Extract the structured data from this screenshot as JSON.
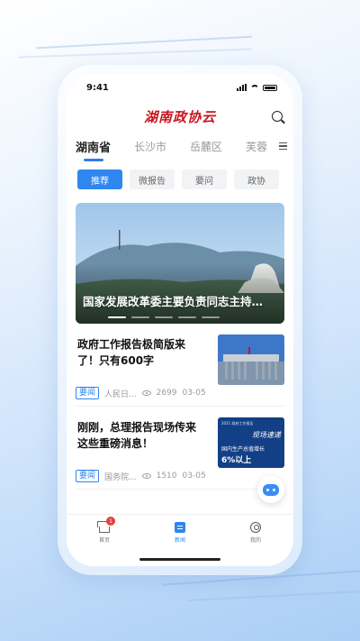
{
  "status_bar": {
    "time": "9:41"
  },
  "header": {
    "logo_text": "湖南政协云"
  },
  "region_tabs": [
    {
      "label": "湖南省",
      "active": true
    },
    {
      "label": "长沙市",
      "active": false
    },
    {
      "label": "岳麓区",
      "active": false
    },
    {
      "label": "芙蓉",
      "active": false
    }
  ],
  "category_tabs": [
    {
      "label": "推荐",
      "active": true
    },
    {
      "label": "微报告",
      "active": false
    },
    {
      "label": "要问",
      "active": false
    },
    {
      "label": "政协",
      "active": false
    }
  ],
  "banner": {
    "caption": "国家发展改革委主要负责同志主持…",
    "slides": 5,
    "active_slide": 1
  },
  "news": [
    {
      "title": "政府工作报告极简版来了！只有600字",
      "tag": "要闻",
      "source": "人民日...",
      "views": "2699",
      "date": "03-05"
    },
    {
      "title": "刚刚，总理报告现场传来这些重磅消息！",
      "tag": "要闻",
      "source": "国务院...",
      "views": "1510",
      "date": "03-05",
      "thumb_text": [
        "2021 政府工作报告",
        "现场速递",
        "国内生产总值增长",
        "6%以上"
      ]
    }
  ],
  "tabbar": [
    {
      "label": "首页",
      "icon": "home-icon",
      "badge": "1",
      "active": false
    },
    {
      "label": "新闻",
      "icon": "news-icon",
      "active": true
    },
    {
      "label": "我的",
      "icon": "profile-icon",
      "active": false
    }
  ],
  "colors": {
    "accent": "#2f86ef",
    "logo": "#c8151d",
    "badge": "#e5413a"
  }
}
